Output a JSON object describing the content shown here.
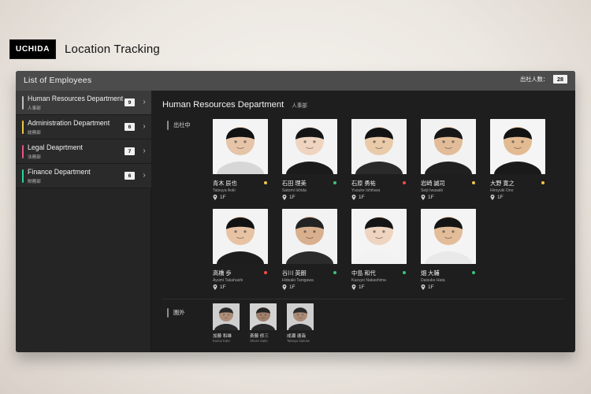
{
  "branding": {
    "logo_text": "UCHIDA",
    "app_title": "Location Tracking"
  },
  "device": {
    "header": {
      "title": "List of Employees",
      "attendance_label": "出社人数：",
      "attendance_count": "28"
    },
    "sidebar": {
      "departments": [
        {
          "name_en": "Human Resources Department",
          "name_ja": "人事部",
          "count": "9",
          "accent": "#bdbdbd",
          "active": true
        },
        {
          "name_en": "Administration Department",
          "name_ja": "総務部",
          "count": "6",
          "accent": "#f0c64a",
          "active": false
        },
        {
          "name_en": "Legal Deaprtment",
          "name_ja": "法務部",
          "count": "7",
          "accent": "#e8528a",
          "active": false
        },
        {
          "name_en": "Finance Department",
          "name_ja": "財務部",
          "count": "6",
          "accent": "#2ed1a1",
          "active": false
        }
      ]
    },
    "content": {
      "dept_title_en": "Human Resources Department",
      "dept_title_ja": "人事部",
      "present_label": "出社中",
      "away_label": "園外",
      "present_employees": [
        {
          "name_ja": "青木 辰也",
          "name_en": "Tatsuya Aoki",
          "floor": "1F",
          "status_color": "#f0c64a",
          "photo": {
            "bg": "#f4f4f4",
            "skin": "#e6c4a8",
            "hair": "#121212",
            "suit": "#d7d7d7"
          }
        },
        {
          "name_ja": "石田 理美",
          "name_en": "Satomi Ishida",
          "floor": "1F",
          "status_color": "#3cc47a",
          "photo": {
            "bg": "#f3f3f3",
            "skin": "#efd4c0",
            "hair": "#151515",
            "suit": "#1b1b1b"
          }
        },
        {
          "name_ja": "石原 勇祐",
          "name_en": "Yusuke Ishihara",
          "floor": "1F",
          "status_color": "#ff4a4a",
          "photo": {
            "bg": "#f2f2f2",
            "skin": "#e9caa9",
            "hair": "#131313",
            "suit": "#2a2a2a"
          }
        },
        {
          "name_ja": "岩崎 誠司",
          "name_en": "Seiji Iwasaki",
          "floor": "1F",
          "status_color": "#f0c64a",
          "photo": {
            "bg": "#f2f2f2",
            "skin": "#e2bc98",
            "hair": "#161616",
            "suit": "#202020"
          }
        },
        {
          "name_ja": "大野 寛之",
          "name_en": "Hiroyuki Ono",
          "floor": "1F",
          "status_color": "#f0c64a",
          "photo": {
            "bg": "#f5f5f5",
            "skin": "#e2bb93",
            "hair": "#121212",
            "suit": "#1a1a1a"
          }
        },
        {
          "name_ja": "高橋 歩",
          "name_en": "Ayumi Takahashi",
          "floor": "1F",
          "status_color": "#ff4a4a",
          "photo": {
            "bg": "#f3f3f3",
            "skin": "#e7c3a4",
            "hair": "#121212",
            "suit": "#1d1d1d"
          }
        },
        {
          "name_ja": "谷川 英朗",
          "name_en": "Hideaki Tanigawa",
          "floor": "1F",
          "status_color": "#3cc47a",
          "photo": {
            "bg": "#f2f2f2",
            "skin": "#d9b08d",
            "hair": "#232323",
            "suit": "#2b2b2b"
          }
        },
        {
          "name_ja": "中島 和代",
          "name_en": "Kazuyo Nakashima",
          "floor": "1F",
          "status_color": "#3cc47a",
          "photo": {
            "bg": "#f4f4f4",
            "skin": "#efd4c0",
            "hair": "#151515",
            "suit": "#f2f2f2"
          }
        },
        {
          "name_ja": "畑 大輔",
          "name_en": "Daisuke Hata",
          "floor": "1F",
          "status_color": "#3cc47a",
          "photo": {
            "bg": "#f4f4f4",
            "skin": "#e3bd99",
            "hair": "#151515",
            "suit": "#e9e9e9"
          }
        }
      ],
      "away_employees": [
        {
          "name_ja": "加藤 和雄",
          "name_en": "Kazuo Kato",
          "photo": {
            "bg": "#cfcfcf",
            "skin": "#b58d73",
            "hair": "#2a2a2a",
            "suit": "#2b2b2b"
          }
        },
        {
          "name_ja": "斎藤 修三",
          "name_en": "Shuzo Saito",
          "photo": {
            "bg": "#d3d3d3",
            "skin": "#a77e66",
            "hair": "#252525",
            "suit": "#2a2a2a"
          }
        },
        {
          "name_ja": "成瀬 達哉",
          "name_en": "Tatsuya Naruse",
          "photo": {
            "bg": "#cfcfcf",
            "skin": "#b08a70",
            "hair": "#2a2a2a",
            "suit": "#2a2a2a"
          }
        }
      ]
    }
  }
}
